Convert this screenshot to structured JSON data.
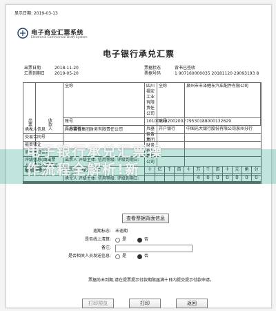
{
  "header": {
    "display_date_label": "显示日期:",
    "display_date_value": "2019-03-13",
    "logo_title": "电子商业汇票系统",
    "logo_subtitle": "Electronic Commercial Draft System",
    "doc_title": "电子银行承兑汇票"
  },
  "meta": {
    "left": [
      {
        "k": "出票日期",
        "v": "2018-11-20"
      },
      {
        "k": "汇票到期日",
        "v": "2019-05-20"
      }
    ],
    "right": [
      {
        "k": "票据状态",
        "v": "背书已签收"
      },
      {
        "k": "票据号码",
        "v": "1 907160000035 20181120 29093193 8"
      }
    ]
  },
  "table": {
    "drawer_label": "出票人",
    "payee_label": "收款人",
    "rows": [
      {
        "l1": "全称",
        "v1": "四川福安工业有限责任公司",
        "l2": "全称",
        "v2": "泉州市丰泽鲤东汽车配件有限公司"
      },
      {
        "l1": "账号",
        "v1": "101002282002002",
        "l2": "账号",
        "v2": "79530188000132629"
      },
      {
        "l1": "开户银行",
        "v1": "兵器装备集团财务有限责任公司",
        "l2": "开户银行",
        "v2": "中国光大银行股份有限公司泉州分行"
      }
    ],
    "amount_label": "票据金额",
    "amount_cny_label": "人民币",
    "amount_cny_note": "(大写)",
    "amount_words": "肆万元整",
    "digit_headers": [
      "十",
      "亿",
      "千",
      "百",
      "十",
      "万",
      "千",
      "百",
      "十",
      "元",
      "角",
      "分"
    ],
    "digit_values": [
      "",
      "",
      "",
      "",
      "",
      "4",
      "0",
      "0",
      "0",
      "0",
      "0",
      "0"
    ]
  },
  "lower": {
    "rows": [
      {
        "label": "承兑人信息",
        "value": "兵器装备集团财务有限责任公司"
      },
      {
        "label": "交易合同号",
        "value": ""
      },
      {
        "label": "能否转让",
        "value": ""
      },
      {
        "label": "承兑保证信息",
        "value": ""
      },
      {
        "label": "评级信息(由出票人、承兑人自己记载,仅供参考)",
        "value": "出票人  评级主体:  信用等级:  评级到期日:"
      },
      {
        "label": "",
        "value": "承兑人  评级主体:  信用等级:  评级到期日:"
      }
    ]
  },
  "overlay": {
    "line1": "电子银行承兑汇票操",
    "line2": "作流程全解析!新"
  },
  "buttons": {
    "view_back": "查看票据背面信息",
    "btn1": "打印预览",
    "btn2": "打印",
    "btn3": "返回"
  },
  "form": {
    "overdue_label": "逾期标志:",
    "overdue_value": "未逾期",
    "q1_label": "是否线上清算:",
    "q1_yes": "是",
    "q1_no": "否",
    "q1_selected": "no",
    "remark_label": "备注:",
    "q2_label": "是否相关人员发送信息:",
    "q2_yes": "是",
    "q2_no": "否",
    "q2_selected": "no"
  },
  "note": "票据尚未到期,请在提票提示付款期限届满十日内提交提示付款申请。"
}
